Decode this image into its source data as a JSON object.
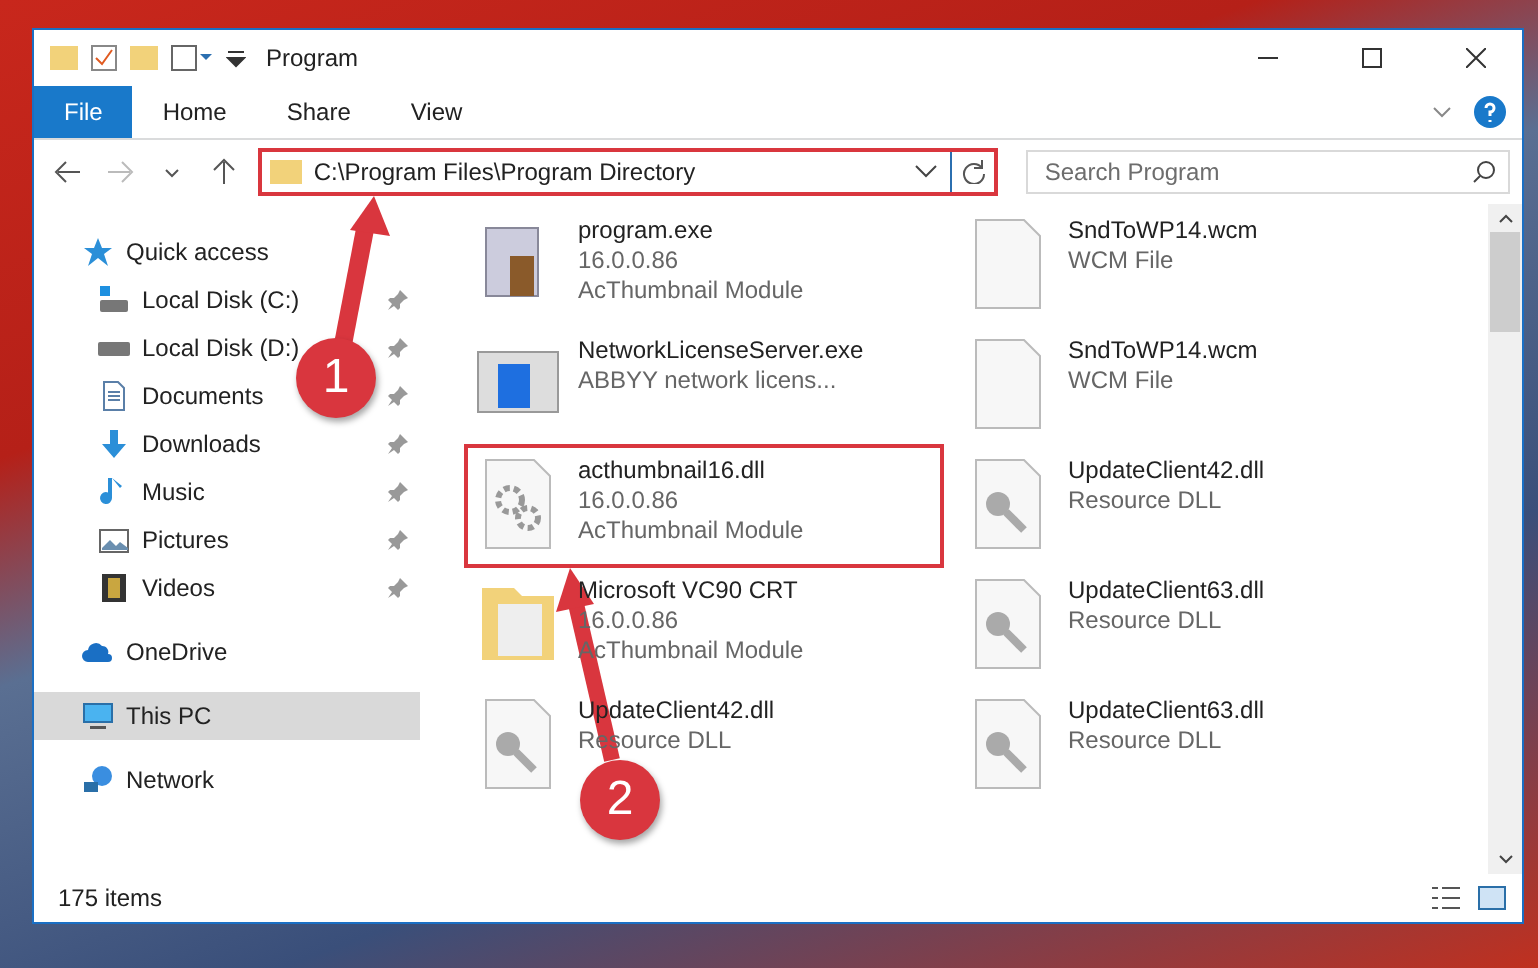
{
  "window": {
    "title": "Program"
  },
  "ribbon_tabs": [
    {
      "label": "File",
      "selected": true
    },
    {
      "label": "Home",
      "selected": false
    },
    {
      "label": "Share",
      "selected": false
    },
    {
      "label": "View",
      "selected": false
    }
  ],
  "address": {
    "path": "C:\\Program Files\\Program Directory",
    "highlighted": true
  },
  "search": {
    "placeholder": "Search Program"
  },
  "sidebar": {
    "items": [
      {
        "label": "Quick access",
        "kind": "star",
        "selected": false,
        "children": [
          {
            "label": "Local Disk (C:)",
            "kind": "drive-win",
            "pinned": true,
            "selected": false
          },
          {
            "label": "Local Disk (D:)",
            "kind": "drive",
            "pinned": true,
            "selected": false
          },
          {
            "label": "Documents",
            "kind": "doc",
            "pinned": true,
            "selected": false
          },
          {
            "label": "Downloads",
            "kind": "download",
            "pinned": true,
            "selected": false
          },
          {
            "label": "Music",
            "kind": "music",
            "pinned": true,
            "selected": false
          },
          {
            "label": "Pictures",
            "kind": "pictures",
            "pinned": true,
            "selected": false
          },
          {
            "label": "Videos",
            "kind": "videos",
            "pinned": true,
            "selected": false
          }
        ]
      },
      {
        "label": "OneDrive",
        "kind": "cloud",
        "selected": false
      },
      {
        "label": "This PC",
        "kind": "pc",
        "selected": true
      },
      {
        "label": "Network",
        "kind": "network",
        "selected": false
      }
    ]
  },
  "files": [
    {
      "name": "program.exe",
      "lines": [
        "16.0.0.86",
        "AcThumbnail Module"
      ],
      "kind": "exe",
      "highlighted": false
    },
    {
      "name": "SndToWP14.wcm",
      "lines": [
        "WCM File"
      ],
      "kind": "blank",
      "highlighted": false
    },
    {
      "name": "NetworkLicenseServer.exe",
      "lines": [
        "ABBYY network licens..."
      ],
      "kind": "app",
      "highlighted": false
    },
    {
      "name": "SndToWP14.wcm",
      "lines": [
        "WCM File"
      ],
      "kind": "blank",
      "highlighted": false
    },
    {
      "name": "acthumbnail16.dll",
      "lines": [
        "16.0.0.86",
        "AcThumbnail Module"
      ],
      "kind": "gears",
      "highlighted": true
    },
    {
      "name": "UpdateClient42.dll",
      "lines": [
        "Resource DLL"
      ],
      "kind": "key",
      "highlighted": false
    },
    {
      "name": "Microsoft VC90 CRT",
      "lines": [
        "16.0.0.86",
        "AcThumbnail Module"
      ],
      "kind": "folder",
      "highlighted": false
    },
    {
      "name": "UpdateClient63.dll",
      "lines": [
        "Resource DLL"
      ],
      "kind": "key",
      "highlighted": false
    },
    {
      "name": "UpdateClient42.dll",
      "lines": [
        "Resource DLL"
      ],
      "kind": "key",
      "highlighted": false
    },
    {
      "name": "UpdateClient63.dll",
      "lines": [
        "Resource DLL"
      ],
      "kind": "key",
      "highlighted": false
    }
  ],
  "status_bar": {
    "count": "175 items"
  },
  "annotations": [
    {
      "label": "1"
    },
    {
      "label": "2"
    }
  ]
}
